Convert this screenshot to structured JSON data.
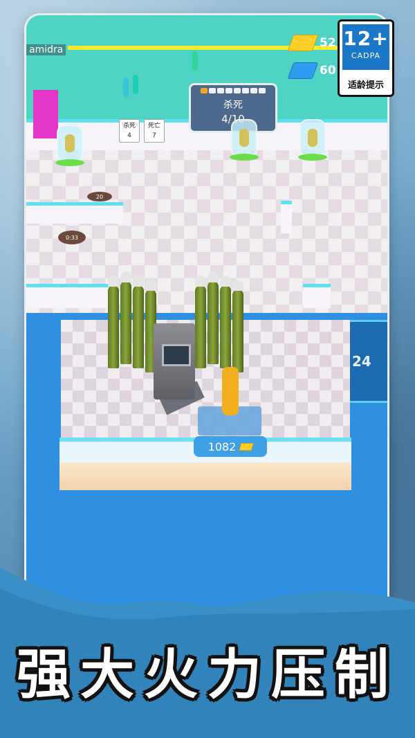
{
  "game": {
    "player_name": "amidra",
    "kill_panel": {
      "title": "杀死",
      "count": "4/10",
      "progress_segments_total": 8,
      "progress_segments_filled": 1
    },
    "stats": [
      {
        "label": "杀死",
        "value": "4"
      },
      {
        "label": "死亡",
        "value": "7"
      }
    ],
    "resources": [
      {
        "name": "gold",
        "value": "52",
        "color": "#ffd02a"
      },
      {
        "name": "gem",
        "value": "60",
        "color": "#2f9cf0"
      }
    ],
    "timer_text": "0:33",
    "pad_tag": "20",
    "turret_price": "1082",
    "side_counter": "24"
  },
  "age_rating": {
    "number": "12+",
    "org": "CADPA",
    "label": "适龄提示"
  },
  "banner": {
    "title": "强大火力压制"
  }
}
